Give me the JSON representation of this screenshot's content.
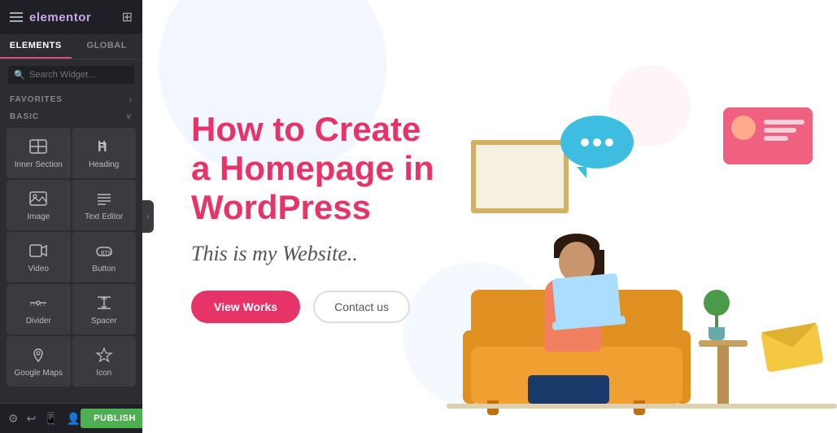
{
  "sidebar": {
    "header": {
      "logo": "elementor",
      "apps_icon": "⊞"
    },
    "tabs": [
      {
        "id": "elements",
        "label": "ELEMENTS",
        "active": true
      },
      {
        "id": "global",
        "label": "GLOBAL",
        "active": false
      }
    ],
    "search": {
      "placeholder": "Search Widget..."
    },
    "favorites_label": "FAVORITES",
    "favorites_arrow": "›",
    "basic_label": "BASIC",
    "basic_arrow": "∨",
    "widgets": [
      {
        "id": "inner-section",
        "icon": "inner_section",
        "label": "Inner Section"
      },
      {
        "id": "heading",
        "icon": "heading",
        "label": "Heading"
      },
      {
        "id": "image",
        "icon": "image",
        "label": "Image"
      },
      {
        "id": "text-editor",
        "icon": "text_editor",
        "label": "Text Editor"
      },
      {
        "id": "video",
        "icon": "video",
        "label": "Video"
      },
      {
        "id": "button",
        "icon": "button",
        "label": "Button"
      },
      {
        "id": "divider",
        "icon": "divider",
        "label": "Divider"
      },
      {
        "id": "spacer",
        "icon": "spacer",
        "label": "Spacer"
      },
      {
        "id": "google-maps",
        "icon": "map",
        "label": "Google Maps"
      },
      {
        "id": "icon",
        "icon": "star",
        "label": "Icon"
      }
    ],
    "bottom_icons": [
      "settings",
      "history",
      "responsive",
      "user"
    ],
    "publish_label": "PUBLISH"
  },
  "preview": {
    "title_line1": "How to Create",
    "title_line2": "a Homepage in",
    "title_line3": "WordPress",
    "subtitle": "This is my Website..",
    "button_primary": "View Works",
    "button_secondary": "Contact us"
  },
  "colors": {
    "brand_pink": "#e63469",
    "sidebar_bg": "#2c2d30",
    "sidebar_header_bg": "#1f2025",
    "publish_green": "#4caf50",
    "widget_bg": "#3a3b3e",
    "tab_active_border": "#e2498a"
  }
}
